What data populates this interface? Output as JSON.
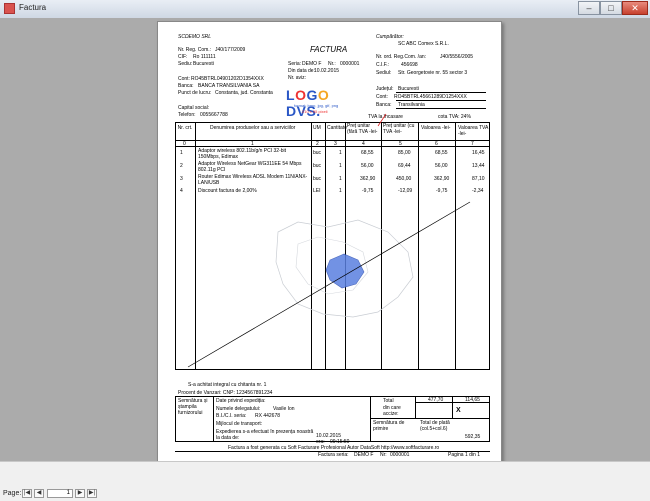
{
  "window": {
    "title": "Factura"
  },
  "seller": {
    "name": "SCDEMO SRL",
    "reg_label": "Nr. Reg. Com.:",
    "reg": "J40/177/2009",
    "cif_label": "CIF:",
    "cif": "Ro 111111",
    "sediu_label": "Sediu:",
    "sediu": "Bucuresti",
    "cont_label": "Cont:",
    "cont": "RO45BTRL04901202D1354XXX",
    "banca_label": "Banca:",
    "banca": "BANCA TRANSILVANIA SA",
    "punct_label": "Punct de lucru:",
    "punct": "Constanta, jud. Constanta",
    "capital_label": "Capital social:",
    "telefon_label": "Telefon:",
    "telefon": "0055667788"
  },
  "invoice": {
    "title": "FACTURA",
    "seria_label": "Seria:",
    "seria": "DEMO F",
    "nr_label": "Nr.:",
    "nr": "0000001",
    "data_label": "Din data de:",
    "data": "10.02.2015",
    "aviz_label": "Nr. aviz:"
  },
  "logo": {
    "text_l": "L",
    "text_o1": "O",
    "text_g": "G",
    "text_o2": "O",
    "text_rest": " DVS.",
    "sub": "format: bmp, jpg, gif, png",
    "dim": "210 x 55 pixeli"
  },
  "buyer": {
    "heading": "Cumpărător:",
    "name": "SC ABC Comex S.R.L.",
    "reg_label": "Nr. ord. Reg.Com. /an:",
    "reg": "J40/5556/2005",
    "cif_label": "C.I.F.:",
    "cif": "456698",
    "sediu_label": "Sediul:",
    "sediu": "Str. Georgetovie nr. 55 sector 3",
    "judet_label": "Județul:",
    "judet": "Bucuresti",
    "cont_label": "Cont:",
    "cont": "RO45BTRL45661289D1254XXX",
    "banca_label": "Banca:",
    "banca": "Transilvania"
  },
  "tva": {
    "incasare": "TVA la încasare",
    "cota": "cota TVA: 24%"
  },
  "table": {
    "headers": [
      "Nr. crt.",
      "Denumirea produselor sau a serviciilor",
      "UM",
      "Cantitate",
      "Preț unitar (fără TVA -lei-",
      "Preț unitar (cu TVA -lei-",
      "Valoarea -lei-",
      "Valoarea TVA -lei-"
    ],
    "col_numbers": [
      "0",
      "1",
      "2",
      "3",
      "4",
      "5",
      "6",
      "7"
    ],
    "rows": [
      {
        "nr": "1",
        "name": "Adaptor wireless 802.11b/g/n PCI 32-bit 150Mbps, Edimax",
        "um": "buc",
        "qty": "1",
        "pu": "68,55",
        "puc": "85,00",
        "val": "68,55",
        "tva": "16,45"
      },
      {
        "nr": "2",
        "name": "Adaptor Wireless NetGear WG311EE 54 Mbps 802.11g PCI",
        "um": "buc",
        "qty": "1",
        "pu": "56,00",
        "puc": "69,44",
        "val": "56,00",
        "tva": "13,44"
      },
      {
        "nr": "3",
        "name": "Router Edimax Wireless ADSL Modem 11N/ANX-LAN/USB",
        "um": "buc",
        "qty": "1",
        "pu": "362,90",
        "puc": "450,00",
        "val": "362,90",
        "tva": "87,10"
      },
      {
        "nr": "4",
        "name": "Discount factura de 2,00%",
        "um": "LEI",
        "qty": "1",
        "pu": "-9,75",
        "puc": "-12,09",
        "val": "-9,75",
        "tva": "-2,34"
      }
    ]
  },
  "notes": {
    "line1": "S-a achitat integral cu chitanta nr. 1",
    "line2": "Procent de Vanzari: CNP: 1234567891234"
  },
  "footer": {
    "sig_label": "Semnătura și ștampila furnizorului",
    "exp_label": "Date privind expediția:",
    "delegat_label": "Numele delegatului:",
    "delegat": "Vasile Ion",
    "bi_label": "B.I./C.I. seria:",
    "bi": "RX 442678",
    "transport_label": "Mijlocul de transport:",
    "expedieres_label": "Expedierea s-a efectuat în prezența noastră la data de:",
    "exp_date": "10.02.2015",
    "ora_label": "ora:",
    "ora": "09:15:50",
    "total_label": "Total",
    "dincare_label": "din care accize:",
    "total_val": "477,70",
    "total_tva": "114,65",
    "x_mark": "X",
    "primire_label": "Semnătura de primire",
    "plata_label": "Total de plată (col.5+col.6)",
    "plata_val": "592,35",
    "generated": "Factura a fost generata cu Soft Facturare Profesional Autor DataSoft http://www.softfacturare.ro",
    "seria_label": "Factura seria:",
    "seria": "DEMO F",
    "nr_label": "Nr:",
    "nr": "0000001",
    "page_label": "Pagina 1 din 1"
  },
  "statusbar": {
    "page_label": "Page:",
    "page_value": "1"
  }
}
